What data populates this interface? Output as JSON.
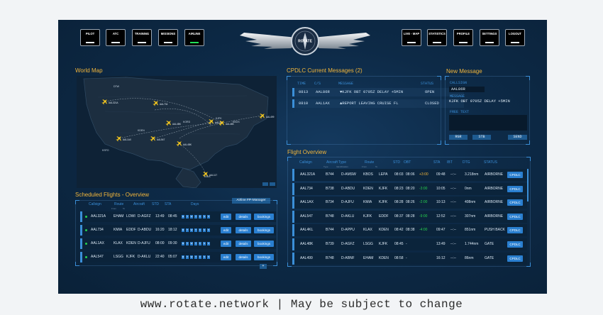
{
  "nav_left": [
    {
      "label": "PILOT",
      "active": false
    },
    {
      "label": "ATC",
      "active": false
    },
    {
      "label": "TRAINING",
      "active": false
    },
    {
      "label": "MISSIONS",
      "active": false
    },
    {
      "label": "AIRLINE",
      "active": true
    }
  ],
  "nav_right": [
    {
      "label": "LIVE - MAP"
    },
    {
      "label": "STATISTICS"
    },
    {
      "label": "PROFILE"
    },
    {
      "label": "SETTINGS"
    },
    {
      "label": "LOGOUT"
    }
  ],
  "logo_text": "ROTATE",
  "world_map": {
    "title": "World Map",
    "aircraft": [
      "AAL734",
      "AAL4BK",
      "AAL547",
      "AAL48K",
      "AAL499",
      "AAL1AX",
      "AAL321A",
      "AAL117"
    ],
    "places": [
      "DTW",
      "KJFK",
      "KORD",
      "EHAM",
      "KDEN",
      "KSFO",
      "KBOS"
    ]
  },
  "cpdlc": {
    "title": "CPDLC Current Messages (2)",
    "headers": {
      "time": "TIME",
      "cs": "C/S",
      "message": "MESSAGE",
      "status": "STATUS"
    },
    "rows": [
      {
        "time": "0813",
        "cs": "AAL86R",
        "message": "▼KJFK OBT 0705Z DELAY +5MIN",
        "status": "OPEN"
      },
      {
        "time": "0810",
        "cs": "AAL1AX",
        "message": "▲REPORT LEAVING CRUISE FL",
        "status": "CLOSED"
      }
    ]
  },
  "new_message": {
    "title": "New Message",
    "callsign_label": "CALLSIGN",
    "callsign_value": "AAL86R",
    "message_label": "MESSAGE",
    "message_value": "KJFK OBT 0705Z DELAY +5MIN",
    "free_text_label": "FREE TEXT",
    "buttons": {
      "rgr": "RGR",
      "stb": "STB",
      "send": "SEND"
    }
  },
  "flight_overview": {
    "title": "Flight Overview",
    "headers": {
      "callsign": "Callsign",
      "aircraft_type": "Aircraft Type",
      "type": "Type",
      "identification": "Identification",
      "route": "Route",
      "from": "From",
      "to": "To",
      "std": "STD",
      "obt": "OBT",
      "sta": "STA",
      "ibt": "IBT",
      "dtg": "DTG",
      "status": "STATUS"
    },
    "button_label": "CPDLC",
    "rows": [
      {
        "cs": "AAL321A",
        "type": "B744",
        "reg": "D-AMSW",
        "from": "KBOS",
        "to": "LEPA",
        "std": "08:03",
        "obt": "08:06",
        "delay": "+3:00",
        "delay_color": "#f3b63b",
        "sta": "09:48",
        "ibt": "--:--",
        "dtg": "3.218nm",
        "status": "AIRBORNE"
      },
      {
        "cs": "AAL734",
        "type": "B738",
        "reg": "D-ABDU",
        "from": "KDEN",
        "to": "KJFK",
        "std": "08:23",
        "obt": "08:20",
        "delay": "-3:00",
        "delay_color": "#27d04f",
        "sta": "10:05",
        "ibt": "--:--",
        "dtg": "0nm",
        "status": "AIRBORNE"
      },
      {
        "cs": "AAL1AX",
        "type": "B734",
        "reg": "D-AJFU",
        "from": "KMIA",
        "to": "KJFK",
        "std": "08:28",
        "obt": "08:26",
        "delay": "-2:00",
        "delay_color": "#27d04f",
        "sta": "10:13",
        "ibt": "--:--",
        "dtg": "408nm",
        "status": "AIRBORNE"
      },
      {
        "cs": "AAL547",
        "type": "B748",
        "reg": "D-AKLU",
        "from": "KJFK",
        "to": "EDDF",
        "std": "08:37",
        "obt": "08:28",
        "delay": "-9:00",
        "delay_color": "#27d04f",
        "sta": "12:52",
        "ibt": "--:--",
        "dtg": "307nm",
        "status": "AIRBORNE"
      },
      {
        "cs": "AAL4KL",
        "type": "B744",
        "reg": "D-APPU",
        "from": "KLAX",
        "to": "KDEN",
        "std": "08:42",
        "obt": "08:38",
        "delay": "-4:00",
        "delay_color": "#27d04f",
        "sta": "09:47",
        "ibt": "--:--",
        "dtg": "851nm",
        "status": "PUSH BACK"
      },
      {
        "cs": "AAL48K",
        "type": "B739",
        "reg": "D-AGFZ",
        "from": "LSGG",
        "to": "KJFK",
        "std": "08:45",
        "obt": "-",
        "delay": "",
        "delay_color": "",
        "sta": "13:49",
        "ibt": "--:--",
        "dtg": "1.744nm",
        "status": "GATE"
      },
      {
        "cs": "AAL499",
        "type": "B748",
        "reg": "D-ABNF",
        "from": "EHAM",
        "to": "KDEN",
        "std": "08:58",
        "obt": "-",
        "delay": "",
        "delay_color": "",
        "sta": "16:12",
        "ibt": "--:--",
        "dtg": "86nm",
        "status": "GATE"
      }
    ]
  },
  "scheduled": {
    "title": "Scheduled Flights - Overview",
    "fp_button": "Airline FP-Manager",
    "headers": {
      "callsign": "Callsign",
      "route": "Route",
      "aircraft": "Aircraft",
      "std": "STD",
      "sta": "STA",
      "days": "Days",
      "from": "From",
      "to": "To"
    },
    "day_letters": [
      "M",
      "T",
      "W",
      "T",
      "F",
      "S",
      "S"
    ],
    "btn_edit": "edit",
    "btn_details": "details",
    "btn_bookings": "bookings",
    "add_label": "+",
    "rows": [
      {
        "cs": "AAL321A",
        "from": "EHAM",
        "to": "LOWI",
        "reg": "D-AGFZ",
        "std": "13:49",
        "sta": "08:45"
      },
      {
        "cs": "AAL734",
        "from": "KMIA",
        "to": "EDDF",
        "reg": "D-ABDU",
        "std": "16:20",
        "sta": "18:12"
      },
      {
        "cs": "AAL1AX",
        "from": "KLAX",
        "to": "KDEN",
        "reg": "D-AJFU",
        "std": "08:00",
        "sta": "09:30"
      },
      {
        "cs": "AAL547",
        "from": "LSGG",
        "to": "KJFK",
        "reg": "D-AKLU",
        "std": "22:40",
        "sta": "05:07"
      }
    ]
  },
  "footer": "www.rotate.network | May be subject to change"
}
